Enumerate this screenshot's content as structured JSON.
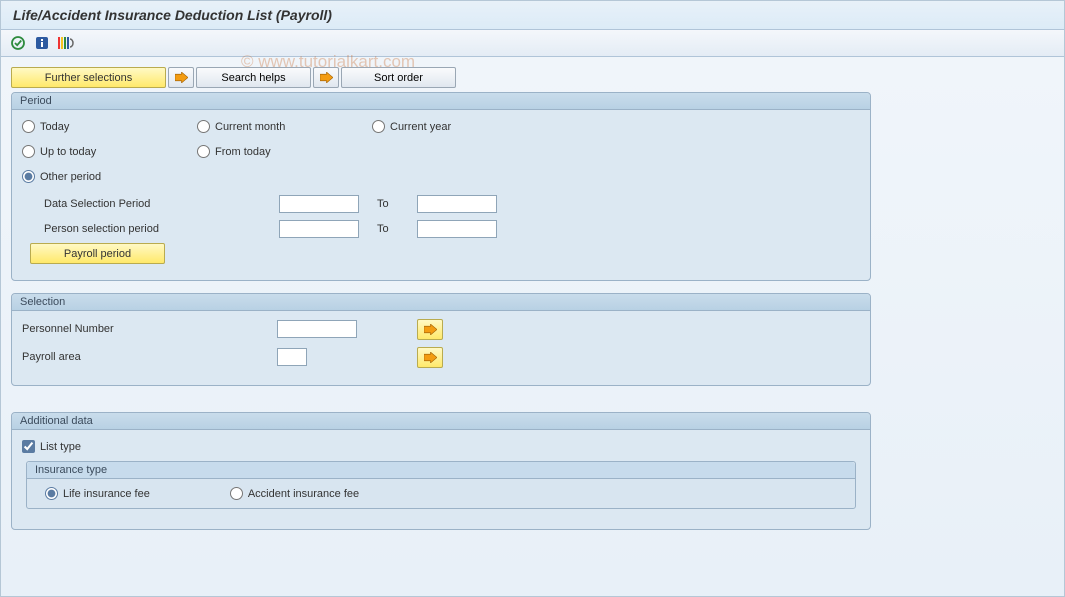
{
  "title": "Life/Accident Insurance Deduction List (Payroll)",
  "watermark": "© www.tutorialkart.com",
  "toolbar_buttons": {
    "further_selections": "Further selections",
    "search_helps": "Search helps",
    "sort_order": "Sort order"
  },
  "period": {
    "title": "Period",
    "radios": {
      "today": "Today",
      "current_month": "Current month",
      "current_year": "Current year",
      "up_to_today": "Up to today",
      "from_today": "From today",
      "other_period": "Other period"
    },
    "data_selection_label": "Data Selection Period",
    "person_selection_label": "Person selection period",
    "to_label": "To",
    "payroll_period_btn": "Payroll period"
  },
  "selection": {
    "title": "Selection",
    "personnel_number": "Personnel Number",
    "payroll_area": "Payroll area"
  },
  "additional": {
    "title": "Additional data",
    "list_type": "List type",
    "insurance_type_title": "Insurance type",
    "life_fee": "Life insurance fee",
    "accident_fee": "Accident insurance fee"
  }
}
